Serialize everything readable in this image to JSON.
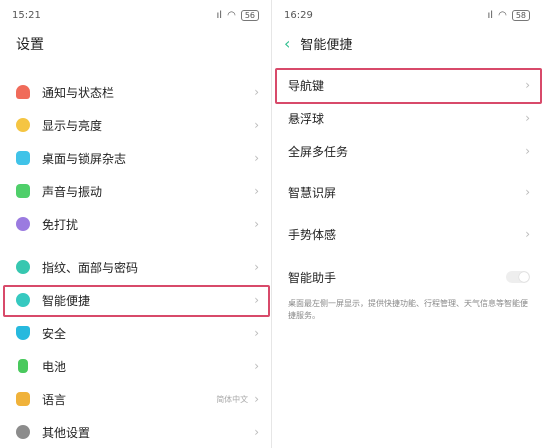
{
  "left": {
    "status": {
      "time": "15:21",
      "signal": "ıl",
      "battery": "56"
    },
    "title": "设置",
    "items": [
      {
        "label": "通知与状态栏",
        "icon": "bell-icon",
        "color": "#f06b5a"
      },
      {
        "label": "显示与亮度",
        "icon": "brightness-icon",
        "color": "#f5c542"
      },
      {
        "label": "桌面与锁屏杂志",
        "icon": "wallpaper-icon",
        "color": "#40c3e8"
      },
      {
        "label": "声音与振动",
        "icon": "speaker-icon",
        "color": "#4fcf6a"
      },
      {
        "label": "免打扰",
        "icon": "moon-icon",
        "color": "#9b7be0"
      },
      {
        "label": "指纹、面部与密码",
        "icon": "fingerprint-icon",
        "color": "#37c7b0"
      },
      {
        "label": "智能便捷",
        "icon": "smart-icon",
        "color": "#36c9c0"
      },
      {
        "label": "安全",
        "icon": "shield-icon",
        "color": "#27b9de"
      },
      {
        "label": "电池",
        "icon": "battery-icon",
        "color": "#49c95d"
      },
      {
        "label": "语言",
        "icon": "language-icon",
        "color": "#f0b23a",
        "value": "简体中文"
      },
      {
        "label": "其他设置",
        "icon": "gear-icon",
        "color": "#8c8c8c"
      }
    ]
  },
  "right": {
    "status": {
      "time": "16:29",
      "signal": "ıl",
      "battery": "58"
    },
    "title": "智能便捷",
    "items": [
      {
        "label": "导航键"
      },
      {
        "label": "悬浮球"
      },
      {
        "label": "全屏多任务"
      },
      {
        "label": "智慧识屏"
      },
      {
        "label": "手势体感"
      },
      {
        "label": "智能助手"
      }
    ],
    "assistant_desc": "桌面最左侧一屏显示，提供快捷功能、行程管理、天气信息等智能便捷服务。"
  },
  "colors": {
    "highlight": "#d84a6a",
    "accent": "#2fbf8f"
  }
}
